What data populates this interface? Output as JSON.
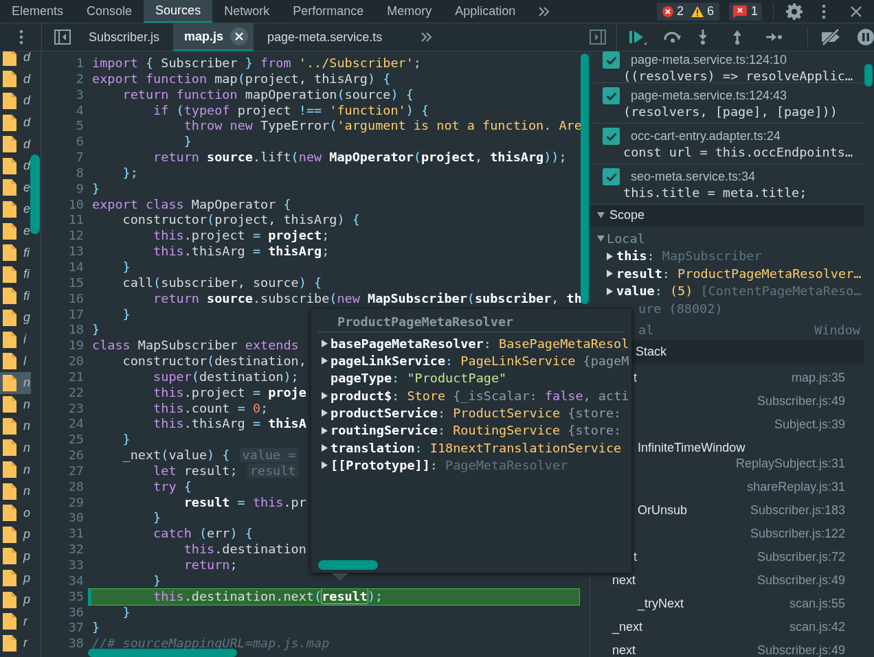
{
  "top_tabs": [
    {
      "label": "Elements",
      "selected": false
    },
    {
      "label": "Console",
      "selected": false
    },
    {
      "label": "Sources",
      "selected": true
    },
    {
      "label": "Network",
      "selected": false
    },
    {
      "label": "Performance",
      "selected": false
    },
    {
      "label": "Memory",
      "selected": false
    },
    {
      "label": "Application",
      "selected": false
    }
  ],
  "counts": {
    "errors": "2",
    "warnings": "6",
    "issues": "1"
  },
  "file_tabs": [
    {
      "label": "Subscriber.js",
      "selected": false
    },
    {
      "label": "map.js",
      "selected": true
    },
    {
      "label": "page-meta.service.ts",
      "selected": false
    }
  ],
  "navigator": {
    "files": [
      {
        "letter": "d",
        "selected": false
      },
      {
        "letter": "d",
        "selected": false
      },
      {
        "letter": "d",
        "selected": false
      },
      {
        "letter": "d",
        "selected": false
      },
      {
        "letter": "d",
        "selected": false
      },
      {
        "letter": "d",
        "selected": false
      },
      {
        "letter": "e",
        "selected": false
      },
      {
        "letter": "e",
        "selected": false
      },
      {
        "letter": "e",
        "selected": false
      },
      {
        "letter": "fi",
        "selected": false
      },
      {
        "letter": "fi",
        "selected": false
      },
      {
        "letter": "fi",
        "selected": false
      },
      {
        "letter": "g",
        "selected": false
      },
      {
        "letter": "i",
        "selected": false
      },
      {
        "letter": "l",
        "selected": false
      },
      {
        "letter": "n",
        "selected": true
      },
      {
        "letter": "n",
        "selected": false
      },
      {
        "letter": "n",
        "selected": false
      },
      {
        "letter": "n",
        "selected": false
      },
      {
        "letter": "n",
        "selected": false
      },
      {
        "letter": "n",
        "selected": false
      },
      {
        "letter": "o",
        "selected": false
      },
      {
        "letter": "p",
        "selected": false
      },
      {
        "letter": "p",
        "selected": false
      },
      {
        "letter": "p",
        "selected": false
      },
      {
        "letter": "p",
        "selected": false
      },
      {
        "letter": "r",
        "selected": false
      },
      {
        "letter": "r",
        "selected": false
      }
    ]
  },
  "editor": {
    "lines": [
      {
        "number": "1",
        "current": false,
        "tokens": [
          {
            "kind": "keyword",
            "text": "import"
          },
          {
            "kind": "punct",
            "text": " {"
          },
          {
            "kind": "text",
            "text": " Subscriber "
          },
          {
            "kind": "punct",
            "text": "}"
          },
          {
            "kind": "keyword",
            "text": " from"
          },
          {
            "kind": "string",
            "text": " '../Subscriber'"
          },
          {
            "kind": "punct",
            "text": ";"
          }
        ]
      },
      {
        "number": "2",
        "current": false,
        "tokens": [
          {
            "kind": "keyword",
            "text": "export"
          },
          {
            "kind": "keyword",
            "text": " function"
          },
          {
            "kind": "text",
            "text": " map"
          },
          {
            "kind": "punct",
            "text": "("
          },
          {
            "kind": "text",
            "text": "project, thisArg"
          },
          {
            "kind": "punct",
            "text": ")"
          },
          {
            "kind": "punct",
            "text": " {"
          }
        ]
      },
      {
        "number": "3",
        "current": false,
        "tokens": [
          {
            "kind": "keyword",
            "text": "    return"
          },
          {
            "kind": "keyword",
            "text": " function"
          },
          {
            "kind": "text",
            "text": " mapOperation"
          },
          {
            "kind": "punct",
            "text": "("
          },
          {
            "kind": "text",
            "text": "source"
          },
          {
            "kind": "punct",
            "text": ")"
          },
          {
            "kind": "punct",
            "text": " {"
          }
        ]
      },
      {
        "number": "4",
        "current": false,
        "tokens": [
          {
            "kind": "keyword",
            "text": "        if"
          },
          {
            "kind": "punct",
            "text": " ("
          },
          {
            "kind": "keyword",
            "text": "typeof"
          },
          {
            "kind": "text",
            "text": " project "
          },
          {
            "kind": "punct",
            "text": "!=="
          },
          {
            "kind": "string",
            "text": " 'function'"
          },
          {
            "kind": "punct",
            "text": ")"
          },
          {
            "kind": "punct",
            "text": " {"
          }
        ]
      },
      {
        "number": "5",
        "current": false,
        "tokens": [
          {
            "kind": "keyword",
            "text": "            throw"
          },
          {
            "kind": "keyword",
            "text": " new"
          },
          {
            "kind": "text",
            "text": " TypeError"
          },
          {
            "kind": "punct",
            "text": "("
          },
          {
            "kind": "string",
            "text": "'argument is not a function. Are"
          }
        ]
      },
      {
        "number": "6",
        "current": false,
        "tokens": [
          {
            "kind": "punct",
            "text": "            }"
          }
        ]
      },
      {
        "number": "7",
        "current": false,
        "tokens": [
          {
            "kind": "keyword",
            "text": "        return"
          },
          {
            "kind": "variable",
            "text": " source"
          },
          {
            "kind": "text",
            "text": ".lift"
          },
          {
            "kind": "punct",
            "text": "("
          },
          {
            "kind": "keyword",
            "text": "new"
          },
          {
            "kind": "variable",
            "text": " MapOperator"
          },
          {
            "kind": "punct",
            "text": "("
          },
          {
            "kind": "variable",
            "text": "project"
          },
          {
            "kind": "text",
            "text": ", "
          },
          {
            "kind": "variable",
            "text": "thisArg"
          },
          {
            "kind": "punct",
            "text": "))"
          },
          {
            "kind": "text",
            "text": ";"
          }
        ]
      },
      {
        "number": "8",
        "current": false,
        "tokens": [
          {
            "kind": "punct",
            "text": "    };"
          }
        ]
      },
      {
        "number": "9",
        "current": false,
        "tokens": [
          {
            "kind": "punct",
            "text": "}"
          }
        ]
      },
      {
        "number": "10",
        "current": false,
        "tokens": [
          {
            "kind": "keyword",
            "text": "export"
          },
          {
            "kind": "keyword",
            "text": " class"
          },
          {
            "kind": "text",
            "text": " MapOperator "
          },
          {
            "kind": "punct",
            "text": "{"
          }
        ]
      },
      {
        "number": "11",
        "current": false,
        "tokens": [
          {
            "kind": "text",
            "text": "    constructor"
          },
          {
            "kind": "punct",
            "text": "("
          },
          {
            "kind": "text",
            "text": "project, thisArg"
          },
          {
            "kind": "punct",
            "text": ")"
          },
          {
            "kind": "punct",
            "text": " {"
          }
        ]
      },
      {
        "number": "12",
        "current": false,
        "tokens": [
          {
            "kind": "keyword",
            "text": "        this"
          },
          {
            "kind": "text",
            "text": ".project "
          },
          {
            "kind": "punct",
            "text": "="
          },
          {
            "kind": "variable",
            "text": " project"
          },
          {
            "kind": "punct",
            "text": ";"
          }
        ]
      },
      {
        "number": "13",
        "current": false,
        "tokens": [
          {
            "kind": "keyword",
            "text": "        this"
          },
          {
            "kind": "text",
            "text": ".thisArg "
          },
          {
            "kind": "punct",
            "text": "="
          },
          {
            "kind": "variable",
            "text": " thisArg"
          },
          {
            "kind": "punct",
            "text": ";"
          }
        ]
      },
      {
        "number": "14",
        "current": false,
        "tokens": [
          {
            "kind": "punct",
            "text": "    }"
          }
        ]
      },
      {
        "number": "15",
        "current": false,
        "tokens": [
          {
            "kind": "text",
            "text": "    call"
          },
          {
            "kind": "punct",
            "text": "("
          },
          {
            "kind": "text",
            "text": "subscriber, source"
          },
          {
            "kind": "punct",
            "text": ")"
          },
          {
            "kind": "punct",
            "text": " {"
          }
        ]
      },
      {
        "number": "16",
        "current": false,
        "tokens": [
          {
            "kind": "keyword",
            "text": "        return"
          },
          {
            "kind": "variable",
            "text": " source"
          },
          {
            "kind": "text",
            "text": ".subscribe"
          },
          {
            "kind": "punct",
            "text": "("
          },
          {
            "kind": "keyword",
            "text": "new"
          },
          {
            "kind": "variable",
            "text": " MapSubscriber"
          },
          {
            "kind": "punct",
            "text": "("
          },
          {
            "kind": "variable",
            "text": "subscriber"
          },
          {
            "kind": "text",
            "text": ", "
          },
          {
            "kind": "variable",
            "text": "th"
          }
        ]
      },
      {
        "number": "17",
        "current": false,
        "tokens": [
          {
            "kind": "punct",
            "text": "    }"
          }
        ]
      },
      {
        "number": "18",
        "current": false,
        "tokens": [
          {
            "kind": "punct",
            "text": "}"
          }
        ]
      },
      {
        "number": "19",
        "current": false,
        "tokens": [
          {
            "kind": "keyword",
            "text": "class"
          },
          {
            "kind": "text",
            "text": " MapSubscriber "
          },
          {
            "kind": "keyword",
            "text": "extends"
          }
        ]
      },
      {
        "number": "20",
        "current": false,
        "tokens": [
          {
            "kind": "text",
            "text": "    constructor"
          },
          {
            "kind": "punct",
            "text": "("
          },
          {
            "kind": "text",
            "text": "destination,"
          }
        ]
      },
      {
        "number": "21",
        "current": false,
        "tokens": [
          {
            "kind": "keyword",
            "text": "        super"
          },
          {
            "kind": "punct",
            "text": "("
          },
          {
            "kind": "text",
            "text": "destination"
          },
          {
            "kind": "punct",
            "text": ");"
          }
        ]
      },
      {
        "number": "22",
        "current": false,
        "tokens": [
          {
            "kind": "keyword",
            "text": "        this"
          },
          {
            "kind": "text",
            "text": ".project "
          },
          {
            "kind": "punct",
            "text": "="
          },
          {
            "kind": "variable",
            "text": " proje"
          }
        ]
      },
      {
        "number": "23",
        "current": false,
        "tokens": [
          {
            "kind": "keyword",
            "text": "        this"
          },
          {
            "kind": "text",
            "text": ".count "
          },
          {
            "kind": "punct",
            "text": "="
          },
          {
            "kind": "number",
            "text": " 0"
          },
          {
            "kind": "punct",
            "text": ";"
          }
        ]
      },
      {
        "number": "24",
        "current": false,
        "tokens": [
          {
            "kind": "keyword",
            "text": "        this"
          },
          {
            "kind": "text",
            "text": ".thisArg "
          },
          {
            "kind": "punct",
            "text": "="
          },
          {
            "kind": "variable",
            "text": " thisA"
          }
        ]
      },
      {
        "number": "25",
        "current": false,
        "tokens": [
          {
            "kind": "punct",
            "text": "    }"
          }
        ]
      },
      {
        "number": "26",
        "current": false,
        "tokens": [
          {
            "kind": "text",
            "text": "    _next"
          },
          {
            "kind": "punct",
            "text": "("
          },
          {
            "kind": "text",
            "text": "value"
          },
          {
            "kind": "punct",
            "text": ")"
          },
          {
            "kind": "punct",
            "text": " {"
          },
          {
            "kind": "hint",
            "text": "value ="
          }
        ]
      },
      {
        "number": "27",
        "current": false,
        "tokens": [
          {
            "kind": "keyword",
            "text": "        let"
          },
          {
            "kind": "text",
            "text": " result"
          },
          {
            "kind": "punct",
            "text": ";"
          },
          {
            "kind": "hint",
            "text": "result"
          }
        ]
      },
      {
        "number": "28",
        "current": false,
        "tokens": [
          {
            "kind": "keyword",
            "text": "        try"
          },
          {
            "kind": "punct",
            "text": " {"
          }
        ]
      },
      {
        "number": "29",
        "current": false,
        "tokens": [
          {
            "kind": "variable",
            "text": "            result"
          },
          {
            "kind": "punct",
            "text": " ="
          },
          {
            "kind": "keyword",
            "text": " this"
          },
          {
            "kind": "text",
            "text": ".pr"
          }
        ]
      },
      {
        "number": "30",
        "current": false,
        "tokens": [
          {
            "kind": "punct",
            "text": "        }"
          }
        ]
      },
      {
        "number": "31",
        "current": false,
        "tokens": [
          {
            "kind": "keyword",
            "text": "        catch"
          },
          {
            "kind": "punct",
            "text": " ("
          },
          {
            "kind": "text",
            "text": "err"
          },
          {
            "kind": "punct",
            "text": ")"
          },
          {
            "kind": "punct",
            "text": " {"
          }
        ]
      },
      {
        "number": "32",
        "current": false,
        "tokens": [
          {
            "kind": "keyword",
            "text": "            this"
          },
          {
            "kind": "text",
            "text": ".destination"
          }
        ]
      },
      {
        "number": "33",
        "current": false,
        "tokens": [
          {
            "kind": "keyword",
            "text": "            return"
          },
          {
            "kind": "punct",
            "text": ";"
          }
        ]
      },
      {
        "number": "34",
        "current": false,
        "tokens": [
          {
            "kind": "punct",
            "text": "        }"
          }
        ]
      },
      {
        "number": "35",
        "current": true,
        "tokens": [
          {
            "kind": "keyword",
            "text": "        this"
          },
          {
            "kind": "text",
            "text": ".destination.next"
          },
          {
            "kind": "punct",
            "text": "("
          },
          {
            "kind": "boxed",
            "text": "result"
          },
          {
            "kind": "punct",
            "text": ");"
          }
        ]
      },
      {
        "number": "36",
        "current": false,
        "tokens": [
          {
            "kind": "punct",
            "text": "    }"
          }
        ]
      },
      {
        "number": "37",
        "current": false,
        "tokens": [
          {
            "kind": "punct",
            "text": "}"
          }
        ]
      },
      {
        "number": "38",
        "current": false,
        "tokens": [
          {
            "kind": "comment",
            "text": "//# sourceMappingURL=map.js.map"
          }
        ]
      }
    ]
  },
  "popover": {
    "title": "ProductPageMetaResolver",
    "properties": [
      {
        "name": "basePageMetaResolver",
        "expandable": true,
        "value": [
          {
            "kind": "punct",
            "text": ":"
          },
          {
            "kind": "type",
            "text": " BasePageMetaResol"
          }
        ]
      },
      {
        "name": "pageLinkService",
        "expandable": true,
        "value": [
          {
            "kind": "punct",
            "text": ":"
          },
          {
            "kind": "type",
            "text": " PageLinkService"
          },
          {
            "kind": "faint",
            "text": " {pageM"
          }
        ]
      },
      {
        "name": "pageType",
        "expandable": false,
        "value": [
          {
            "kind": "punct",
            "text": ":"
          },
          {
            "kind": "green",
            "text": " \"ProductPage\""
          }
        ]
      },
      {
        "name": "product$",
        "expandable": true,
        "value": [
          {
            "kind": "punct",
            "text": ":"
          },
          {
            "kind": "type",
            "text": " Store"
          },
          {
            "kind": "faint",
            "text": " {_isScalar: "
          },
          {
            "kind": "bool",
            "text": "false"
          },
          {
            "kind": "faint",
            "text": ", acti"
          }
        ]
      },
      {
        "name": "productService",
        "expandable": true,
        "value": [
          {
            "kind": "punct",
            "text": ":"
          },
          {
            "kind": "type",
            "text": " ProductService"
          },
          {
            "kind": "faint",
            "text": " {store:"
          }
        ]
      },
      {
        "name": "routingService",
        "expandable": true,
        "value": [
          {
            "kind": "punct",
            "text": ":"
          },
          {
            "kind": "type",
            "text": " RoutingService"
          },
          {
            "kind": "faint",
            "text": " {store:"
          }
        ]
      },
      {
        "name": "translation",
        "expandable": true,
        "value": [
          {
            "kind": "punct",
            "text": ":"
          },
          {
            "kind": "type",
            "text": " I18nextTranslationService"
          }
        ]
      },
      {
        "name": "[[Prototype]]",
        "expandable": true,
        "value": [
          {
            "kind": "punct",
            "text": ":"
          },
          {
            "kind": "dim",
            "text": " PageMetaResolver"
          }
        ]
      }
    ]
  },
  "breakpoints": [
    {
      "checked": true,
      "location": "page-meta.service.ts:124:10",
      "code": "((resolvers) => resolveApplic…"
    },
    {
      "checked": true,
      "location": "page-meta.service.ts:124:43",
      "code": "(resolvers, [page], [page]))"
    },
    {
      "checked": true,
      "location": "occ-cart-entry.adapter.ts:24",
      "code": "const url = this.occEndpoints…"
    },
    {
      "checked": true,
      "location": "seo-meta.service.ts:34",
      "code": "this.title = meta.title;"
    }
  ],
  "scope": {
    "title": "Scope",
    "expanded": true,
    "local": {
      "label": "Local",
      "expanded": true,
      "entries": [
        {
          "name": "this",
          "expanded": false,
          "value": [
            {
              "kind": "punct",
              "text": ":"
            },
            {
              "kind": "dim",
              "text": " MapSubscriber"
            }
          ]
        },
        {
          "name": "result",
          "expanded": false,
          "value": [
            {
              "kind": "punct",
              "text": ":"
            },
            {
              "kind": "type",
              "text": " ProductPageMetaResolver…"
            }
          ]
        },
        {
          "name": "value",
          "expanded": false,
          "value": [
            {
              "kind": "punct",
              "text": ":"
            },
            {
              "kind": "type",
              "text": " (5)"
            },
            {
              "kind": "dim",
              "text": " [ContentPageMetaReso…"
            }
          ]
        }
      ]
    },
    "closure": "ure (88002)",
    "global": {
      "label": "al",
      "value": "Window"
    }
  },
  "call_stack": {
    "title": "Stack",
    "frames": [
      {
        "function": "t",
        "location": "map.js:35"
      },
      {
        "location": "Subscriber.js:49"
      },
      {
        "location": "Subject.js:39"
      },
      {
        "function": "InfiniteTimeWindow",
        "location": "ReplaySubject.js:31"
      },
      {
        "location": "shareReplay.js:31"
      },
      {
        "function": "OrUnsub",
        "location": "Subscriber.js:183"
      },
      {
        "location": "Subscriber.js:122"
      },
      {
        "function": "t",
        "location": "Subscriber.js:72"
      },
      {
        "function": "next",
        "location": "Subscriber.js:49"
      },
      {
        "function": "_tryNext",
        "location": "scan.js:55"
      },
      {
        "function": "_next",
        "location": "scan.js:42"
      },
      {
        "function": "next",
        "location": "Subscriber.js:49"
      }
    ]
  }
}
